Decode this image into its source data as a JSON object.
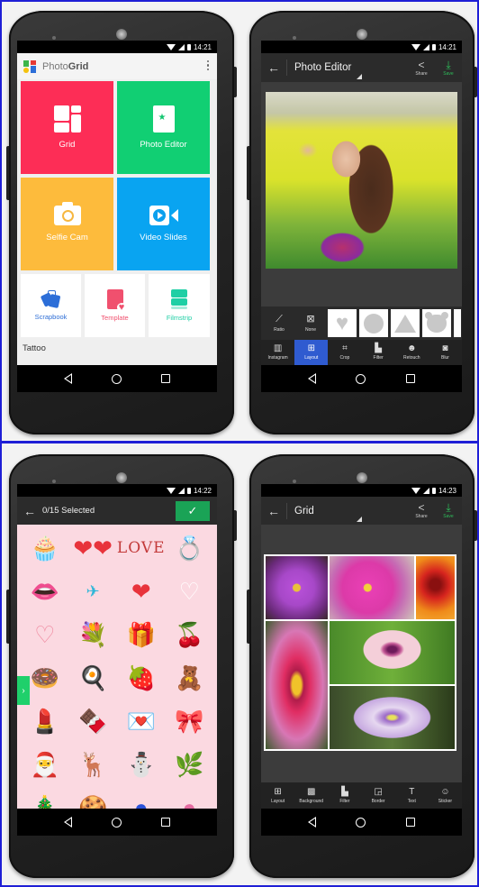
{
  "phones": {
    "home": {
      "status_time": "14:21",
      "app_title_light": "Photo",
      "app_title_bold": "Grid",
      "tiles": [
        {
          "label": "Grid",
          "icon": "grid-layout-icon",
          "color": "#fd2d56"
        },
        {
          "label": "Photo Editor",
          "icon": "magic-wand-photo-icon",
          "color": "#11cf73"
        },
        {
          "label": "Selfie Cam",
          "icon": "camera-icon",
          "color": "#fdbb3c"
        },
        {
          "label": "Video Slides",
          "icon": "video-camera-icon",
          "color": "#09a4f1"
        }
      ],
      "small_tiles": [
        {
          "label": "Scrapbook",
          "icon": "scrapbook-icon",
          "color": "#2f6fd6"
        },
        {
          "label": "Template",
          "icon": "template-heart-icon",
          "color": "#f0506e"
        },
        {
          "label": "Filmstrip",
          "icon": "filmstrip-icon",
          "color": "#1fcfa5"
        }
      ],
      "section_label": "Tattoo"
    },
    "photo_editor": {
      "status_time": "14:21",
      "title": "Photo Editor",
      "share_label": "Share",
      "save_label": "Save",
      "save_color": "#2ebd5a",
      "shape_tools": [
        {
          "label": "Ratio",
          "icon": "ratio-icon"
        },
        {
          "label": "None",
          "icon": "no-shape-icon"
        }
      ],
      "shapes": [
        "heart",
        "circle",
        "triangle",
        "bear"
      ],
      "tools": [
        {
          "label": "Instagram",
          "icon": "instagram-frame-icon",
          "active": false
        },
        {
          "label": "Layout",
          "icon": "layout-icon",
          "active": true
        },
        {
          "label": "Crop",
          "icon": "crop-icon",
          "active": false
        },
        {
          "label": "Filter",
          "icon": "filter-icon",
          "active": false
        },
        {
          "label": "Retouch",
          "icon": "retouch-icon",
          "active": false
        },
        {
          "label": "Blur",
          "icon": "blur-icon",
          "active": false
        }
      ],
      "active_tool_color": "#2f5bd0"
    },
    "sticker_picker": {
      "status_time": "14:22",
      "selected_text": "0/15 Selected",
      "confirm_color": "#1aa356",
      "love_text": "LOVE",
      "background_color": "#fbd9e1",
      "stickers": [
        "cupcake",
        "hearts-couple",
        "love-text",
        "diamond-ring",
        "lips",
        "paper-plane",
        "red-hearts",
        "lace-heart-white",
        "lace-heart-pink",
        "flower-bouquet",
        "gift-box",
        "cherries",
        "donut",
        "heart-egg",
        "strawberries",
        "teddy-bear",
        "lipstick",
        "chocolate",
        "love-letter",
        "red-bow",
        "santa",
        "reindeer",
        "snowman",
        "holly",
        "christmas-tree",
        "gingerbread",
        "blue-ornament",
        "pink-ornament"
      ]
    },
    "grid_editor": {
      "status_time": "14:23",
      "title": "Grid",
      "share_label": "Share",
      "save_label": "Save",
      "save_color": "#2ebd5a",
      "photos": [
        "purple-violet",
        "pink-violet",
        "orange-hibiscus",
        "pink-hibiscus",
        "pink-poppy",
        "purple-clematis"
      ],
      "tools": [
        {
          "label": "Layout",
          "icon": "layout-icon"
        },
        {
          "label": "Background",
          "icon": "checker-background-icon"
        },
        {
          "label": "Filter",
          "icon": "filter-icon"
        },
        {
          "label": "Border",
          "icon": "border-icon"
        },
        {
          "label": "Text",
          "icon": "text-icon"
        },
        {
          "label": "Sticker",
          "icon": "smiley-sticker-icon"
        }
      ]
    }
  },
  "frame_color": "#1f1fd6"
}
